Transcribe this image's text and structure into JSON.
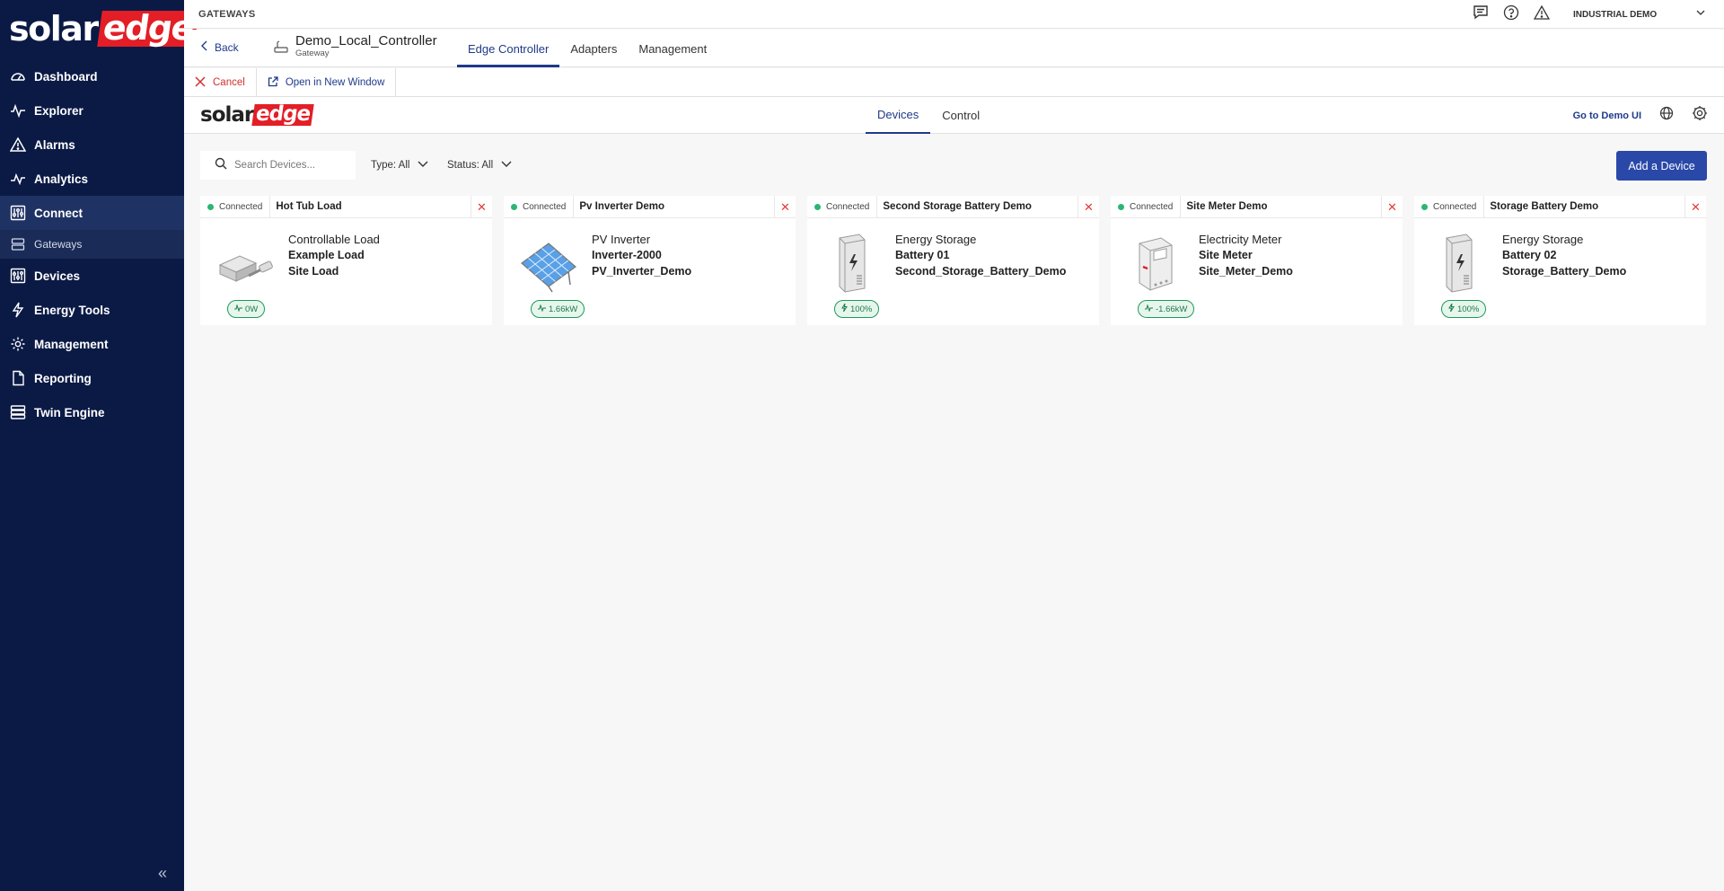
{
  "brand": {
    "solar": "solar",
    "edge": "edge"
  },
  "sidebar": {
    "items": [
      {
        "label": "Dashboard",
        "icon": "dashboard-gauge-icon"
      },
      {
        "label": "Explorer",
        "icon": "explorer-pulse-icon"
      },
      {
        "label": "Alarms",
        "icon": "alarm-triangle-icon"
      },
      {
        "label": "Analytics",
        "icon": "analytics-pulse-icon"
      },
      {
        "label": "Connect",
        "icon": "connect-sliders-icon"
      },
      {
        "label": "Gateways",
        "icon": "gateway-server-icon"
      },
      {
        "label": "Devices",
        "icon": "devices-sliders-icon"
      },
      {
        "label": "Energy Tools",
        "icon": "bolt-icon"
      },
      {
        "label": "Management",
        "icon": "gear-icon"
      },
      {
        "label": "Reporting",
        "icon": "document-icon"
      },
      {
        "label": "Twin Engine",
        "icon": "server-stack-icon"
      }
    ]
  },
  "topbar": {
    "crumb": "GATEWAYS",
    "org": "INDUSTRIAL DEMO"
  },
  "gateway": {
    "back": "Back",
    "name": "Demo_Local_Controller",
    "type": "Gateway",
    "tabs": [
      "Edge Controller",
      "Adapters",
      "Management"
    ]
  },
  "actions": {
    "cancel": "Cancel",
    "open": "Open in New Window"
  },
  "inner": {
    "tabs": [
      "Devices",
      "Control"
    ],
    "demo_link": "Go to Demo UI"
  },
  "toolbar": {
    "search_placeholder": "Search Devices...",
    "type_filter": "Type: All",
    "status_filter": "Status: All",
    "add": "Add a Device"
  },
  "colors": {
    "sidebar": "#0b1a45",
    "accent": "#2a48a8",
    "brand_red": "#e31e26",
    "status_green": "#2bb673"
  },
  "devices": [
    {
      "status": "Connected",
      "name": "Hot Tub Load",
      "type": "Controllable Load",
      "line1": "Example Load",
      "line2": "Site Load",
      "badge": "0W",
      "badge_icon": "pulse-icon",
      "image": "controllable-load"
    },
    {
      "status": "Connected",
      "name": "Pv Inverter Demo",
      "type": "PV Inverter",
      "line1": "Inverter-2000",
      "line2": "PV_Inverter_Demo",
      "badge": "1.66kW",
      "badge_icon": "pulse-icon",
      "image": "solar-panel"
    },
    {
      "status": "Connected",
      "name": "Second Storage Battery Demo",
      "type": "Energy Storage",
      "line1": "Battery 01",
      "line2": "Second_Storage_Battery_Demo",
      "badge": "100%",
      "badge_icon": "bolt-icon",
      "image": "battery"
    },
    {
      "status": "Connected",
      "name": "Site Meter Demo",
      "type": "Electricity Meter",
      "line1": "Site Meter",
      "line2": "Site_Meter_Demo",
      "badge": "-1.66kW",
      "badge_icon": "pulse-icon",
      "image": "meter"
    },
    {
      "status": "Connected",
      "name": "Storage Battery Demo",
      "type": "Energy Storage",
      "line1": "Battery 02",
      "line2": "Storage_Battery_Demo",
      "badge": "100%",
      "badge_icon": "bolt-icon",
      "image": "battery"
    }
  ]
}
